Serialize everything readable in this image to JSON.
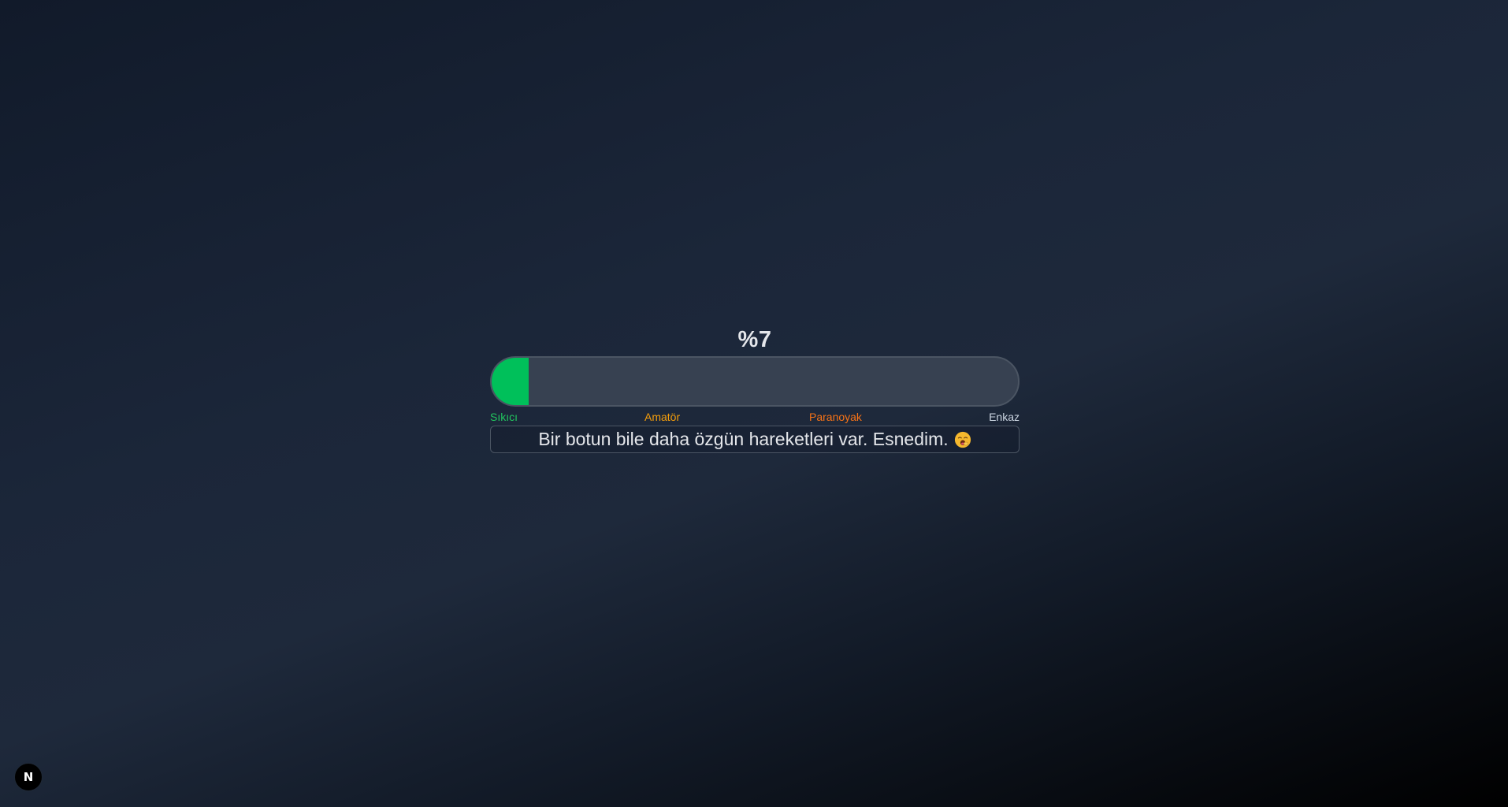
{
  "meter": {
    "percent_label": "%7",
    "value_percent": 7,
    "fill_color": "#00c05a",
    "scale": {
      "sikici": "Sıkıcı",
      "amator": "Amatör",
      "paranoyak": "Paranoyak",
      "enkaz": "Enkaz"
    }
  },
  "message": {
    "text": "Bir botun bile daha özgün hareketleri var. Esnedim.",
    "emoji_icon": "yawning-face-icon"
  },
  "dev_badge": {
    "label": "N",
    "icon": "nextjs-icon"
  }
}
